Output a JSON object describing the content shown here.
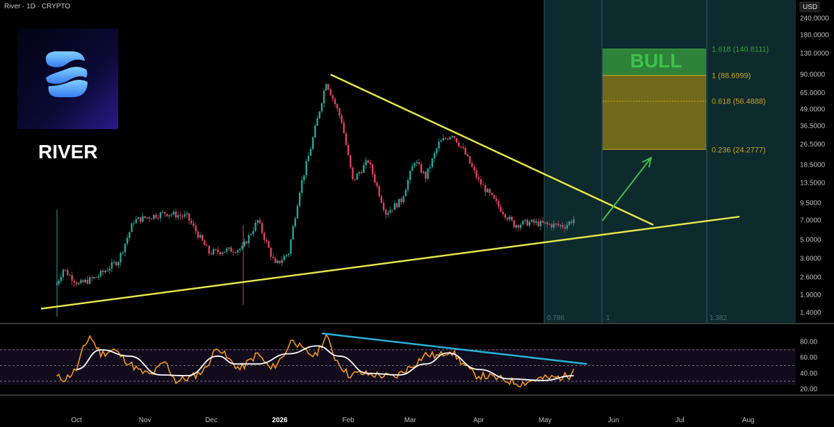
{
  "header": {
    "symbol": "River · 1D · CRYPTO",
    "currency": "USD"
  },
  "brand": {
    "name": "RIVER"
  },
  "annotation": {
    "bull_label": "BULL"
  },
  "colors": {
    "background": "#000000",
    "up_candle": "#26a69a",
    "down_candle": "#e0435f",
    "trendline": "#e8e54a",
    "arrow": "#3ec24a",
    "rsi_line": "#f39a1e",
    "rsi_ma": "#ffffff",
    "divergence_line": "#27b3d8",
    "fib_green": "#3ba03f",
    "fib_gold": "#8c7a17"
  },
  "chart_data": [
    {
      "type": "candlestick",
      "yscale": "log",
      "ylim": [
        1.2,
        260
      ],
      "y_ticks": [
        "240.0000",
        "180.0000",
        "130.0000",
        "90.0000",
        "65.0000",
        "49.0000",
        "36.5000",
        "26.5000",
        "18.5000",
        "13.5000",
        "9.5000",
        "7.0000",
        "5.0000",
        "3.6000",
        "2.6000",
        "1.9000",
        "1.4000"
      ],
      "x_ticks": [
        "Oct",
        "Nov",
        "Dec",
        "2026",
        "Feb",
        "Mar",
        "Apr",
        "May",
        "Jun",
        "Jul",
        "Aug"
      ],
      "anchor_points": [
        {
          "date": "2025-09-22",
          "close": 2.3
        },
        {
          "date": "2025-09-25",
          "close": 3.0
        },
        {
          "date": "2025-10-02",
          "close": 2.3
        },
        {
          "date": "2025-10-10",
          "close": 2.6
        },
        {
          "date": "2025-10-20",
          "close": 3.5
        },
        {
          "date": "2025-10-27",
          "close": 7.0
        },
        {
          "date": "2025-11-10",
          "close": 8.0
        },
        {
          "date": "2025-11-20",
          "close": 7.5
        },
        {
          "date": "2025-11-30",
          "close": 4.0
        },
        {
          "date": "2025-12-15",
          "close": 4.3
        },
        {
          "date": "2025-12-22",
          "close": 7.0
        },
        {
          "date": "2025-12-30",
          "close": 3.2
        },
        {
          "date": "2026-01-05",
          "close": 4.0
        },
        {
          "date": "2026-01-10",
          "close": 12.0
        },
        {
          "date": "2026-01-15",
          "close": 25.0
        },
        {
          "date": "2026-01-22",
          "close": 80.0
        },
        {
          "date": "2026-01-29",
          "close": 40.0
        },
        {
          "date": "2026-02-03",
          "close": 14.0
        },
        {
          "date": "2026-02-10",
          "close": 20.0
        },
        {
          "date": "2026-02-18",
          "close": 8.0
        },
        {
          "date": "2026-02-25",
          "close": 10.0
        },
        {
          "date": "2026-03-03",
          "close": 20.0
        },
        {
          "date": "2026-03-08",
          "close": 15.0
        },
        {
          "date": "2026-03-14",
          "close": 27.0
        },
        {
          "date": "2026-03-20",
          "close": 32.0
        },
        {
          "date": "2026-03-25",
          "close": 24.0
        },
        {
          "date": "2026-04-01",
          "close": 14.0
        },
        {
          "date": "2026-04-10",
          "close": 9.0
        },
        {
          "date": "2026-04-17",
          "close": 6.5
        },
        {
          "date": "2026-04-24",
          "close": 6.8
        },
        {
          "date": "2026-05-03",
          "close": 6.5
        },
        {
          "date": "2026-05-10",
          "close": 6.4
        },
        {
          "date": "2026-05-14",
          "close": 7.2
        }
      ],
      "trendlines": [
        {
          "name": "support",
          "from": {
            "date": "2025-09-15",
            "price": 1.5
          },
          "to": {
            "date": "2026-07-28",
            "price": 7.5
          }
        },
        {
          "name": "resistance",
          "from": {
            "date": "2026-01-24",
            "price": 90
          },
          "to": {
            "date": "2026-06-19",
            "price": 6.5
          }
        }
      ],
      "arrow": {
        "from": {
          "date": "2026-05-27",
          "price": 7.0
        },
        "to": {
          "date": "2026-06-18",
          "price": 21.0
        }
      },
      "fib_levels": [
        {
          "ratio": "1.618",
          "price": 140.8111,
          "label": "1.618 (140.8111)",
          "color": "#3ba03f"
        },
        {
          "ratio": "1",
          "price": 88.6999,
          "label": "1 (88.6999)",
          "color": "#c9a227"
        },
        {
          "ratio": "0.618",
          "price": 56.4888,
          "label": "0.618 (56.4888)",
          "color": "#c9a227"
        },
        {
          "ratio": "0.236",
          "price": 24.2777,
          "label": "0.236 (24.2777)",
          "color": "#c9a227"
        }
      ],
      "time_fib_labels": [
        "0.786",
        "1",
        "1.382"
      ]
    },
    {
      "type": "line",
      "name_hidden": "rsi",
      "ylim": [
        15,
        100
      ],
      "y_ticks": [
        "80.00",
        "60.00",
        "40.00",
        "20.00"
      ],
      "levels": [
        70,
        50,
        30
      ],
      "rsi_anchor": [
        {
          "date": "2025-09-22",
          "value": 35
        },
        {
          "date": "2025-09-26",
          "value": 33
        },
        {
          "date": "2025-10-01",
          "value": 45
        },
        {
          "date": "2025-10-04",
          "value": 70
        },
        {
          "date": "2025-10-07",
          "value": 88
        },
        {
          "date": "2025-10-12",
          "value": 65
        },
        {
          "date": "2025-10-18",
          "value": 70
        },
        {
          "date": "2025-10-24",
          "value": 55
        },
        {
          "date": "2025-10-30",
          "value": 42
        },
        {
          "date": "2025-11-04",
          "value": 38
        },
        {
          "date": "2025-11-10",
          "value": 55
        },
        {
          "date": "2025-11-15",
          "value": 30
        },
        {
          "date": "2025-11-22",
          "value": 35
        },
        {
          "date": "2025-11-28",
          "value": 45
        },
        {
          "date": "2025-12-04",
          "value": 75
        },
        {
          "date": "2025-12-08",
          "value": 60
        },
        {
          "date": "2025-12-14",
          "value": 45
        },
        {
          "date": "2025-12-22",
          "value": 65
        },
        {
          "date": "2025-12-28",
          "value": 45
        },
        {
          "date": "2026-01-02",
          "value": 60
        },
        {
          "date": "2026-01-07",
          "value": 85
        },
        {
          "date": "2026-01-11",
          "value": 70
        },
        {
          "date": "2026-01-17",
          "value": 62
        },
        {
          "date": "2026-01-22",
          "value": 88
        },
        {
          "date": "2026-01-26",
          "value": 60
        },
        {
          "date": "2026-02-01",
          "value": 38
        },
        {
          "date": "2026-02-06",
          "value": 40
        },
        {
          "date": "2026-02-14",
          "value": 38
        },
        {
          "date": "2026-02-22",
          "value": 35
        },
        {
          "date": "2026-03-02",
          "value": 50
        },
        {
          "date": "2026-03-08",
          "value": 64
        },
        {
          "date": "2026-03-14",
          "value": 62
        },
        {
          "date": "2026-03-19",
          "value": 70
        },
        {
          "date": "2026-03-24",
          "value": 55
        },
        {
          "date": "2026-03-30",
          "value": 38
        },
        {
          "date": "2026-04-05",
          "value": 36
        },
        {
          "date": "2026-04-12",
          "value": 32
        },
        {
          "date": "2026-04-20",
          "value": 27
        },
        {
          "date": "2026-04-28",
          "value": 33
        },
        {
          "date": "2026-05-08",
          "value": 35
        },
        {
          "date": "2026-05-12",
          "value": 37
        },
        {
          "date": "2026-05-14",
          "value": 50
        }
      ],
      "ma_anchor": [
        {
          "date": "2025-10-01",
          "value": 45
        },
        {
          "date": "2025-10-12",
          "value": 70
        },
        {
          "date": "2025-10-25",
          "value": 62
        },
        {
          "date": "2025-11-08",
          "value": 38
        },
        {
          "date": "2025-11-20",
          "value": 37
        },
        {
          "date": "2025-12-04",
          "value": 62
        },
        {
          "date": "2025-12-12",
          "value": 52
        },
        {
          "date": "2025-12-22",
          "value": 52
        },
        {
          "date": "2026-01-05",
          "value": 65
        },
        {
          "date": "2026-01-18",
          "value": 75
        },
        {
          "date": "2026-01-28",
          "value": 62
        },
        {
          "date": "2026-02-10",
          "value": 40
        },
        {
          "date": "2026-02-24",
          "value": 38
        },
        {
          "date": "2026-03-08",
          "value": 52
        },
        {
          "date": "2026-03-18",
          "value": 66
        },
        {
          "date": "2026-04-01",
          "value": 45
        },
        {
          "date": "2026-04-15",
          "value": 33
        },
        {
          "date": "2026-04-30",
          "value": 31
        },
        {
          "date": "2026-05-14",
          "value": 37
        }
      ],
      "divergence_line": {
        "from": {
          "date": "2026-01-20",
          "value": 91
        },
        "to": {
          "date": "2026-05-20",
          "value": 52
        }
      }
    }
  ]
}
